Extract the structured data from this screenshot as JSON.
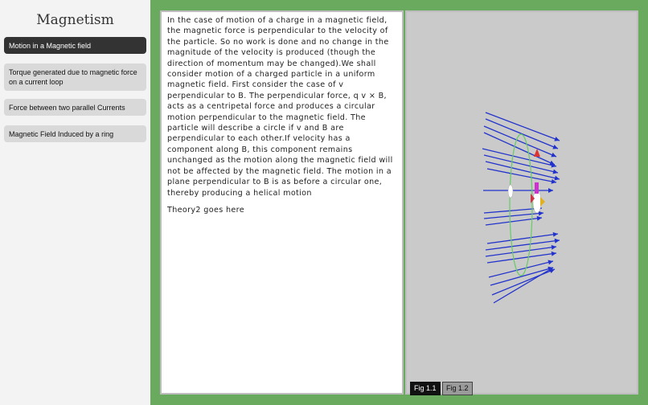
{
  "sidebar": {
    "title": "Magnetism",
    "items": [
      {
        "label": "Motion in a Magnetic field",
        "active": true
      },
      {
        "label": "Torque generated due to magnetic force on a current loop",
        "active": false
      },
      {
        "label": "Force between two parallel Currents",
        "active": false
      },
      {
        "label": "Magnetic Field Induced by a ring",
        "active": false
      }
    ]
  },
  "theory": {
    "paragraph1": "In the case of motion of a charge in a magnetic field, the magnetic force is perpendicular to the velocity of the particle. So no work is done and no change in the magnitude of the velocity is produced (though the direction of momentum may be changed).We shall consider motion of a charged particle in a uniform magnetic field. First consider the case of v perpendicular to B. The perpendicular force, q v × B, acts as a centripetal force and produces a circular motion perpendicular to the magnetic field. The particle will describe a circle if v and B are perpendicular to each other.If velocity has a component along B, this component remains unchanged as the motion along the magnetic field will not be affected by the magnetic field. The motion in a plane perpendicular to B is as before a circular one, thereby producing a helical motion",
    "paragraph2": "Theory2 goes here"
  },
  "figure_buttons": {
    "fig1": "Fig 1.1",
    "fig2": "Fig 1.2"
  },
  "colors": {
    "frame": "#6aaa5f",
    "field_lines": "#2233cc",
    "orbit": "#66cc66",
    "active_nav": "#333333"
  }
}
